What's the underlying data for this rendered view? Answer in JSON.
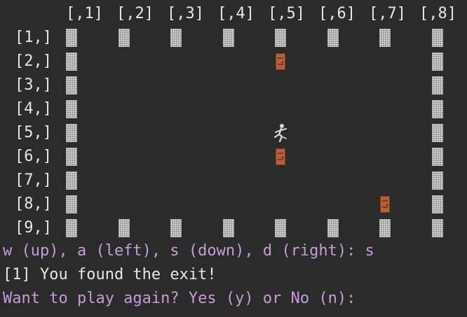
{
  "grid": {
    "col_headers": [
      "[,1]",
      "[,2]",
      "[,3]",
      "[,4]",
      "[,5]",
      "[,6]",
      "[,7]",
      "[,8]"
    ],
    "row_headers": [
      "[1,]",
      "[2,]",
      "[3,]",
      "[4,]",
      "[5,]",
      "[6,]",
      "[7,]",
      "[8,]",
      "[9,]"
    ],
    "walls": [
      [
        1,
        1
      ],
      [
        1,
        2
      ],
      [
        1,
        3
      ],
      [
        1,
        4
      ],
      [
        1,
        5
      ],
      [
        1,
        6
      ],
      [
        1,
        7
      ],
      [
        1,
        8
      ],
      [
        2,
        1
      ],
      [
        2,
        8
      ],
      [
        3,
        1
      ],
      [
        3,
        8
      ],
      [
        4,
        1
      ],
      [
        4,
        8
      ],
      [
        5,
        1
      ],
      [
        5,
        8
      ],
      [
        6,
        1
      ],
      [
        6,
        8
      ],
      [
        7,
        1
      ],
      [
        7,
        8
      ],
      [
        8,
        1
      ],
      [
        8,
        8
      ],
      [
        9,
        1
      ],
      [
        9,
        2
      ],
      [
        9,
        3
      ],
      [
        9,
        4
      ],
      [
        9,
        5
      ],
      [
        9,
        6
      ],
      [
        9,
        7
      ],
      [
        9,
        8
      ]
    ],
    "doors": [
      [
        2,
        5
      ],
      [
        6,
        5
      ],
      [
        8,
        7
      ]
    ],
    "player": [
      5,
      5
    ],
    "icons": {
      "wall": "wall-tile-icon",
      "door": "door-icon",
      "player": "player-runner-icon"
    },
    "colors": {
      "door": "#b65f38",
      "wall": "#9a9a9a",
      "prompt": "#c79bd8"
    }
  },
  "console": {
    "controls_prompt": "w (up), a (left), s (down), d (right): s",
    "result_message": "[1] You found the exit!",
    "play_again_prompt": "Want to play again? Yes (y) or No (n):"
  }
}
